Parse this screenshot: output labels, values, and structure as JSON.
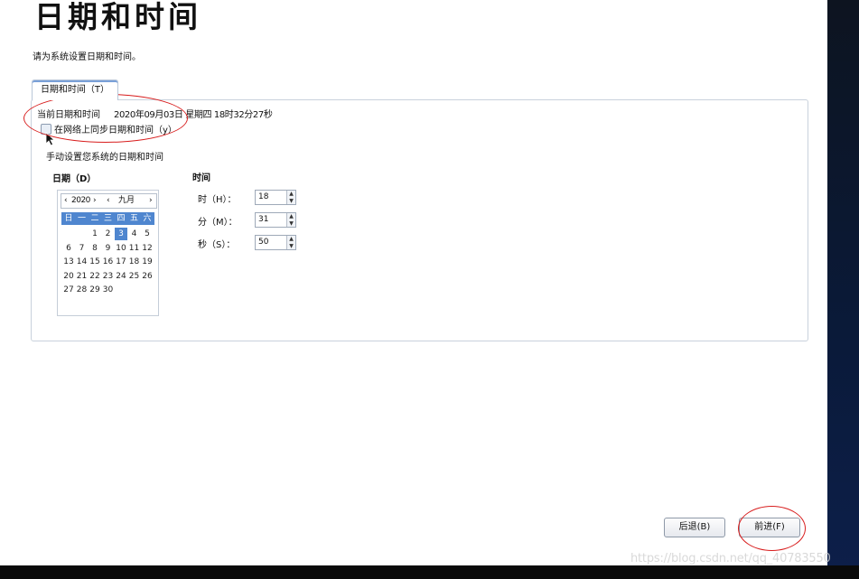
{
  "page": {
    "title": "日期和时间",
    "subtitle": "请为系统设置日期和时间。"
  },
  "tab": {
    "label": "日期和时间（T）"
  },
  "current": {
    "label": "当前日期和时间",
    "value": "2020年09月03日 星期四 18时32分27秒"
  },
  "sync": {
    "label": "在网络上同步日期和时间（y）",
    "checked": false
  },
  "manual": {
    "label": "手动设置您系统的日期和时间"
  },
  "date": {
    "heading": "日期（D）",
    "year_prev": "‹",
    "year": "2020",
    "year_next": "›",
    "month_prev": "‹",
    "month": "九月",
    "month_next": "›",
    "weekdays": [
      "日",
      "一",
      "二",
      "三",
      "四",
      "五",
      "六"
    ],
    "weeks": [
      [
        "",
        "",
        "1",
        "2",
        "3",
        "4",
        "5"
      ],
      [
        "6",
        "7",
        "8",
        "9",
        "10",
        "11",
        "12"
      ],
      [
        "13",
        "14",
        "15",
        "16",
        "17",
        "18",
        "19"
      ],
      [
        "20",
        "21",
        "22",
        "23",
        "24",
        "25",
        "26"
      ],
      [
        "27",
        "28",
        "29",
        "30",
        "",
        "",
        ""
      ]
    ],
    "selected_day": "3"
  },
  "time": {
    "heading": "时间",
    "hour_label": "时（H）：",
    "hour_value": "18",
    "minute_label": "分（M）：",
    "minute_value": "31",
    "second_label": "秒（S）：",
    "second_value": "50"
  },
  "buttons": {
    "back": "后退(B)",
    "next": "前进(F)"
  },
  "watermark": "https://blog.csdn.net/qq_40783550",
  "colors": {
    "accent": "#4f86cf",
    "annotation": "#d81e1e"
  }
}
